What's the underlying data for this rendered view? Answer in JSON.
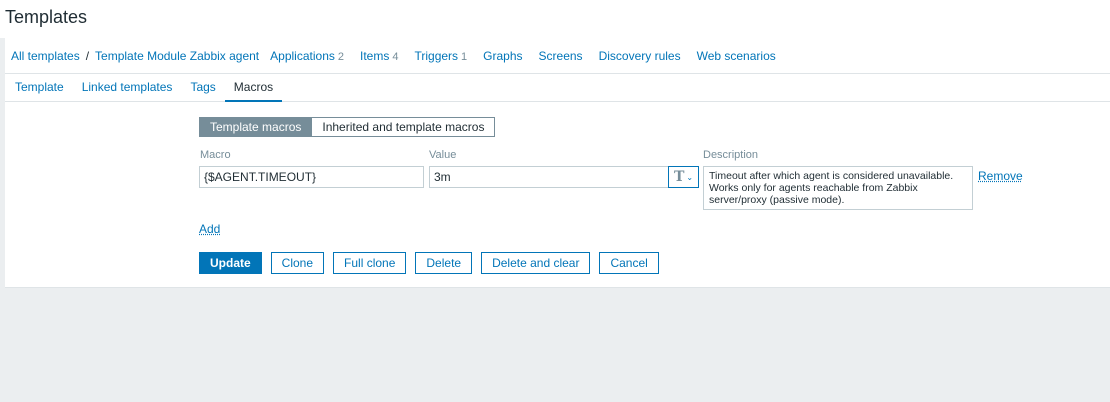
{
  "header": {
    "title": "Templates"
  },
  "breadcrumbs": {
    "all_templates": "All templates",
    "separator": "/",
    "current_template": "Template Module Zabbix agent",
    "nav": [
      {
        "label": "Applications",
        "count": "2"
      },
      {
        "label": "Items",
        "count": "4"
      },
      {
        "label": "Triggers",
        "count": "1"
      },
      {
        "label": "Graphs",
        "count": ""
      },
      {
        "label": "Screens",
        "count": ""
      },
      {
        "label": "Discovery rules",
        "count": ""
      },
      {
        "label": "Web scenarios",
        "count": ""
      }
    ]
  },
  "tabs": [
    {
      "label": "Template",
      "active": false
    },
    {
      "label": "Linked templates",
      "active": false
    },
    {
      "label": "Tags",
      "active": false
    },
    {
      "label": "Macros",
      "active": true
    }
  ],
  "macro_mode": {
    "options": [
      "Template macros",
      "Inherited and template macros"
    ],
    "selected": "Template macros"
  },
  "columns": {
    "macro": "Macro",
    "value": "Value",
    "description": "Description"
  },
  "macros": [
    {
      "macro": "{$AGENT.TIMEOUT}",
      "value": "3m",
      "type_icon": "text-type-icon",
      "type_glyph": "T",
      "description": "Timeout after which agent is considered unavailable. Works only for agents reachable from Zabbix server/proxy (passive mode).",
      "remove_label": "Remove"
    }
  ],
  "add_label": "Add",
  "buttons": {
    "update": "Update",
    "clone": "Clone",
    "full_clone": "Full clone",
    "delete": "Delete",
    "delete_and_clear": "Delete and clear",
    "cancel": "Cancel"
  },
  "colors": {
    "accent": "#0275b8",
    "muted": "#768d99",
    "background": "#ebeef0"
  }
}
